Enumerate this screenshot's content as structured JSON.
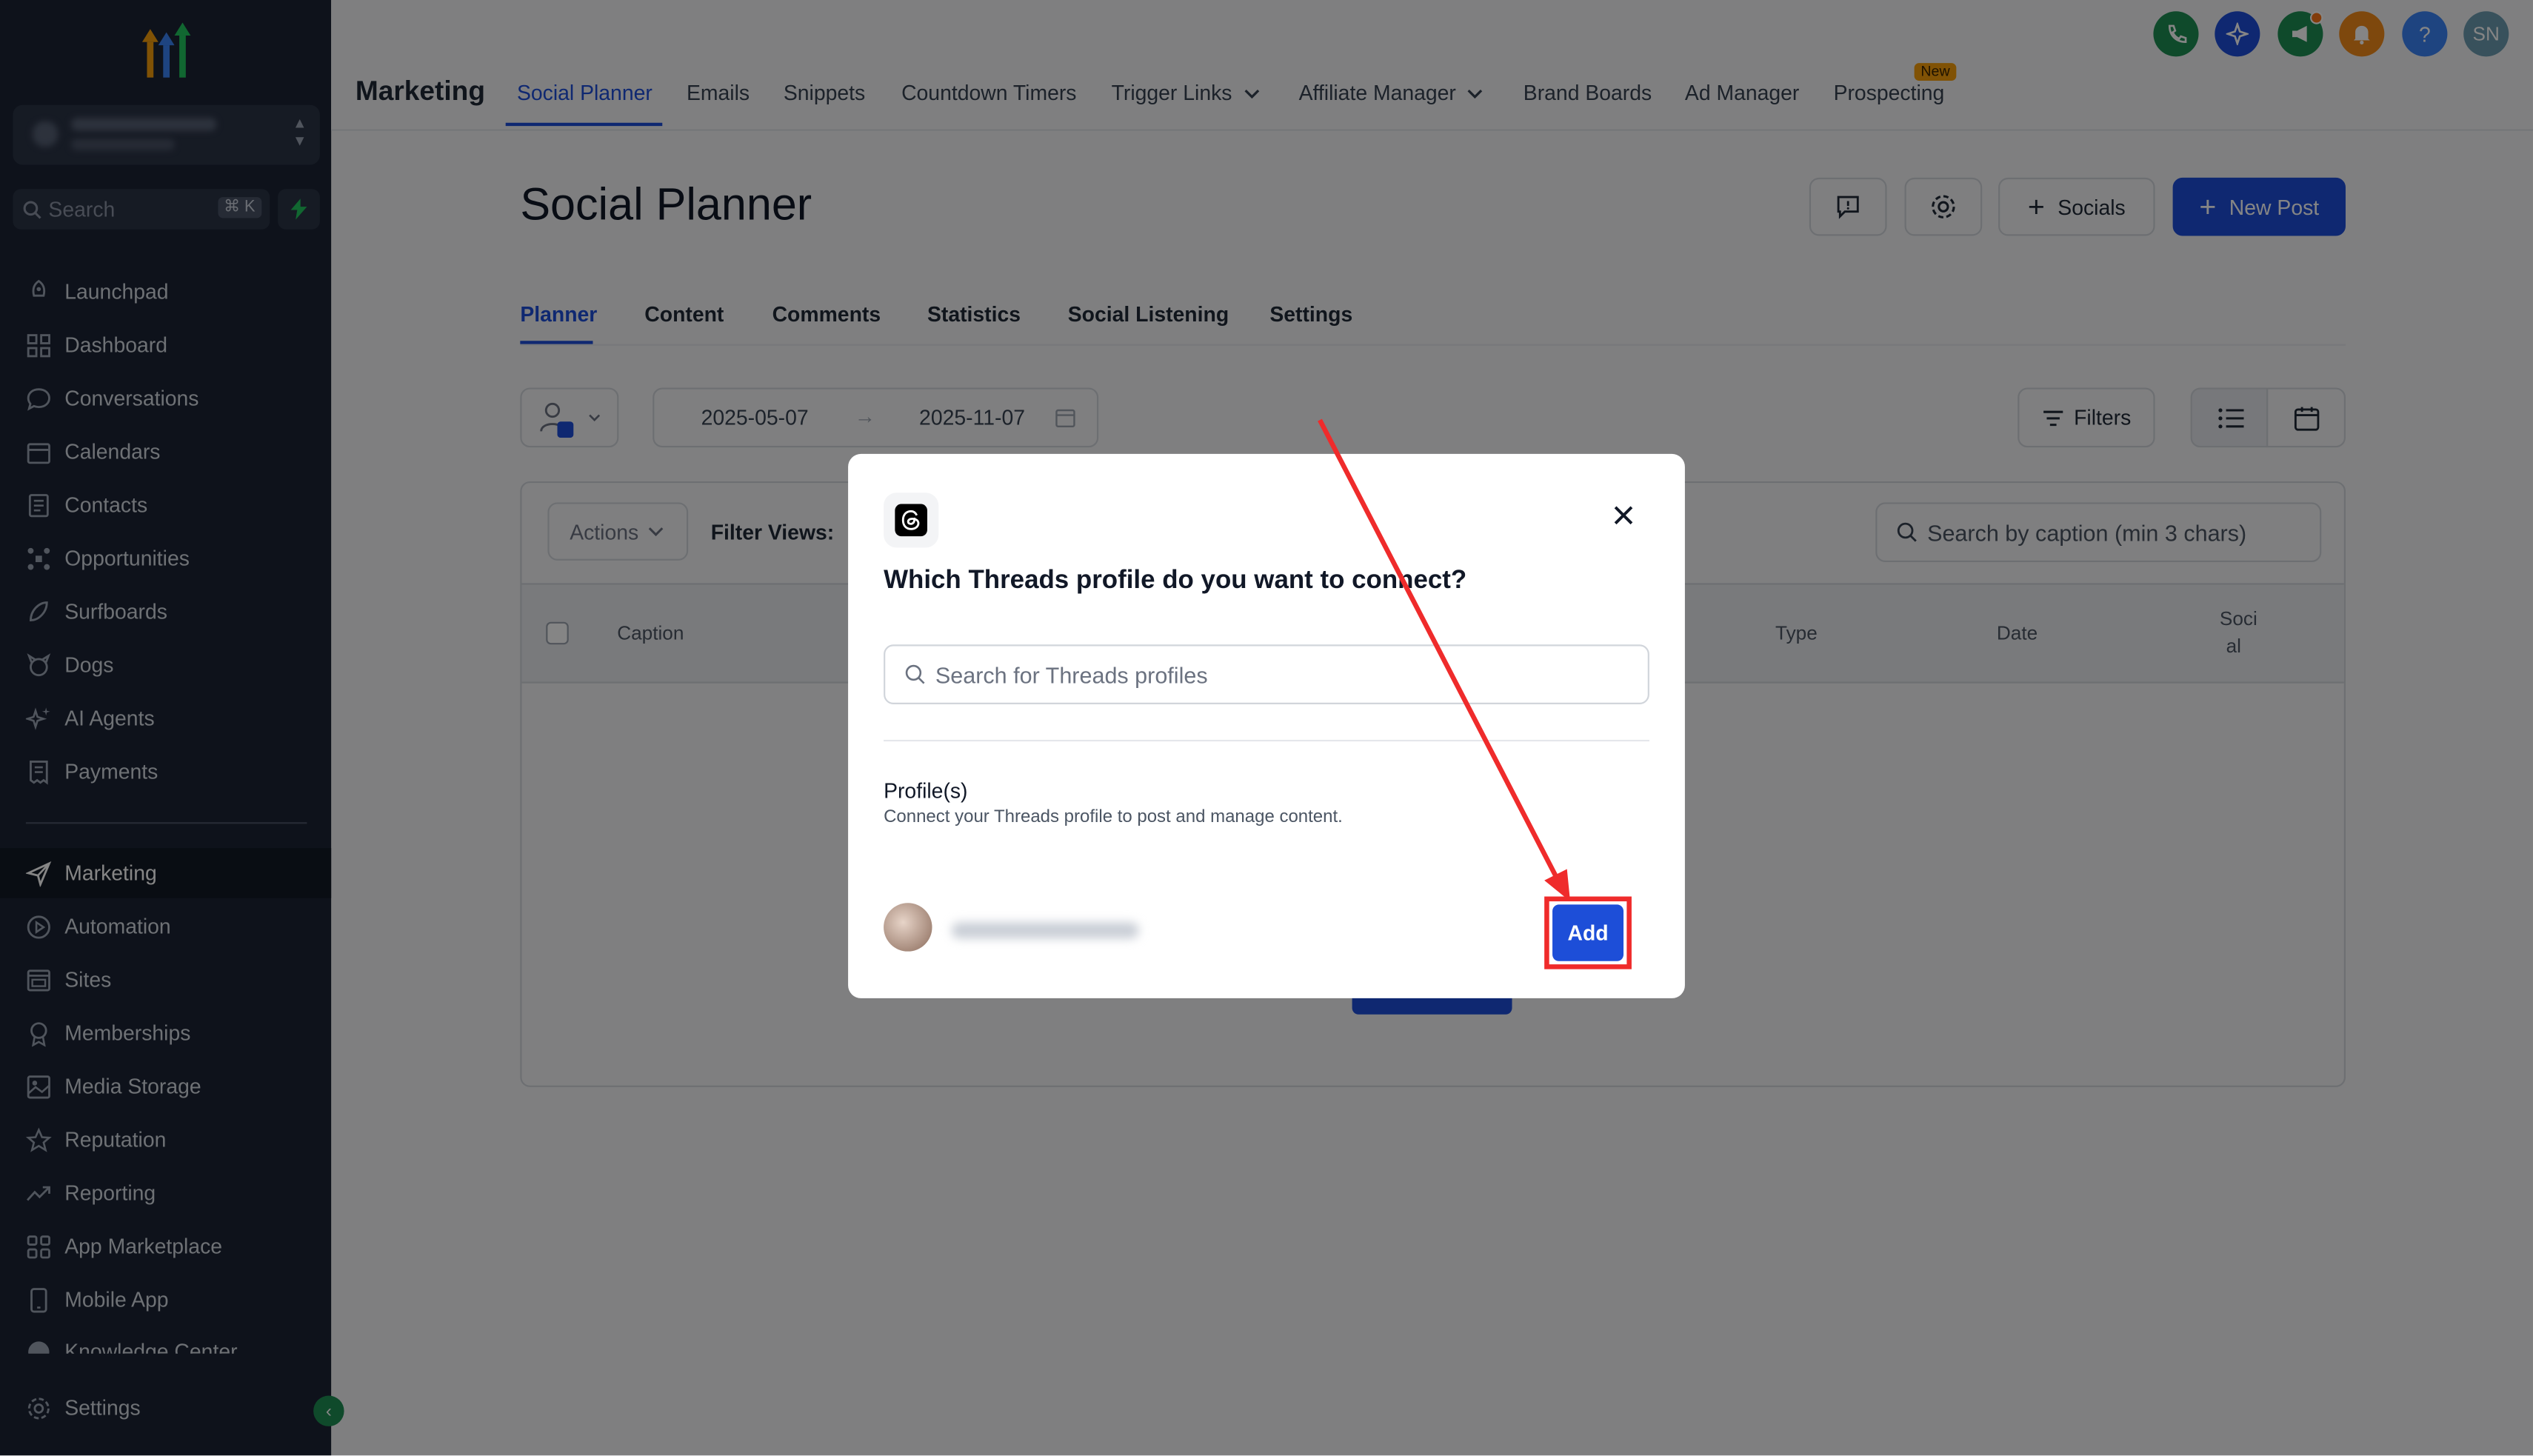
{
  "sidebar": {
    "search_placeholder": "Search",
    "search_shortcut": "⌘ K",
    "items": [
      {
        "label": "Launchpad",
        "icon": "rocket-icon"
      },
      {
        "label": "Dashboard",
        "icon": "dashboard-icon"
      },
      {
        "label": "Conversations",
        "icon": "chat-icon"
      },
      {
        "label": "Calendars",
        "icon": "calendar-icon"
      },
      {
        "label": "Contacts",
        "icon": "contacts-icon"
      },
      {
        "label": "Opportunities",
        "icon": "opportunities-icon"
      },
      {
        "label": "Surfboards",
        "icon": "surfboard-icon"
      },
      {
        "label": "Dogs",
        "icon": "dog-icon"
      },
      {
        "label": "AI Agents",
        "icon": "sparkle-icon"
      },
      {
        "label": "Payments",
        "icon": "receipt-icon"
      }
    ],
    "items2": [
      {
        "label": "Marketing",
        "icon": "send-icon",
        "active": true
      },
      {
        "label": "Automation",
        "icon": "automation-icon"
      },
      {
        "label": "Sites",
        "icon": "sites-icon"
      },
      {
        "label": "Memberships",
        "icon": "membership-icon"
      },
      {
        "label": "Media Storage",
        "icon": "image-icon"
      },
      {
        "label": "Reputation",
        "icon": "star-icon"
      },
      {
        "label": "Reporting",
        "icon": "trend-icon"
      },
      {
        "label": "App Marketplace",
        "icon": "apps-icon"
      },
      {
        "label": "Mobile App",
        "icon": "mobile-icon"
      },
      {
        "label": "Knowledge Center",
        "icon": "book-icon"
      }
    ],
    "settings_label": "Settings"
  },
  "topbar": {
    "module_title": "Marketing",
    "tabs": [
      "Social Planner",
      "Emails",
      "Snippets",
      "Countdown Timers",
      "Trigger Links",
      "Affiliate Manager",
      "Brand Boards",
      "Ad Manager",
      "Prospecting"
    ],
    "new_badge": "New",
    "avatar_initials": "SN",
    "help_label": "?"
  },
  "page": {
    "title": "Social Planner",
    "socials_label": "Socials",
    "new_post_label": "New Post",
    "subtabs": [
      "Planner",
      "Content",
      "Comments",
      "Statistics",
      "Social Listening",
      "Settings"
    ],
    "date_start": "2025-05-07",
    "date_end": "2025-11-07",
    "filters_label": "Filters",
    "actions_label": "Actions",
    "filter_views_label": "Filter Views:",
    "caption_search_placeholder": "Search by caption (min 3 chars)",
    "columns": {
      "caption": "Caption",
      "type": "Type",
      "date": "Date",
      "social_1": "Soci",
      "social_2": "al"
    }
  },
  "modal": {
    "title": "Which Threads profile do you want to connect?",
    "search_placeholder": "Search for Threads profiles",
    "section_title": "Profile(s)",
    "section_subtitle": "Connect your Threads profile to post and manage content.",
    "add_label": "Add"
  },
  "colors": {
    "sidebar_bg": "#1c2434",
    "primary": "#1d4ed8",
    "highlight": "#ef2b2b",
    "phone_green": "#1e8e54",
    "bell_orange": "#f28a1a"
  }
}
